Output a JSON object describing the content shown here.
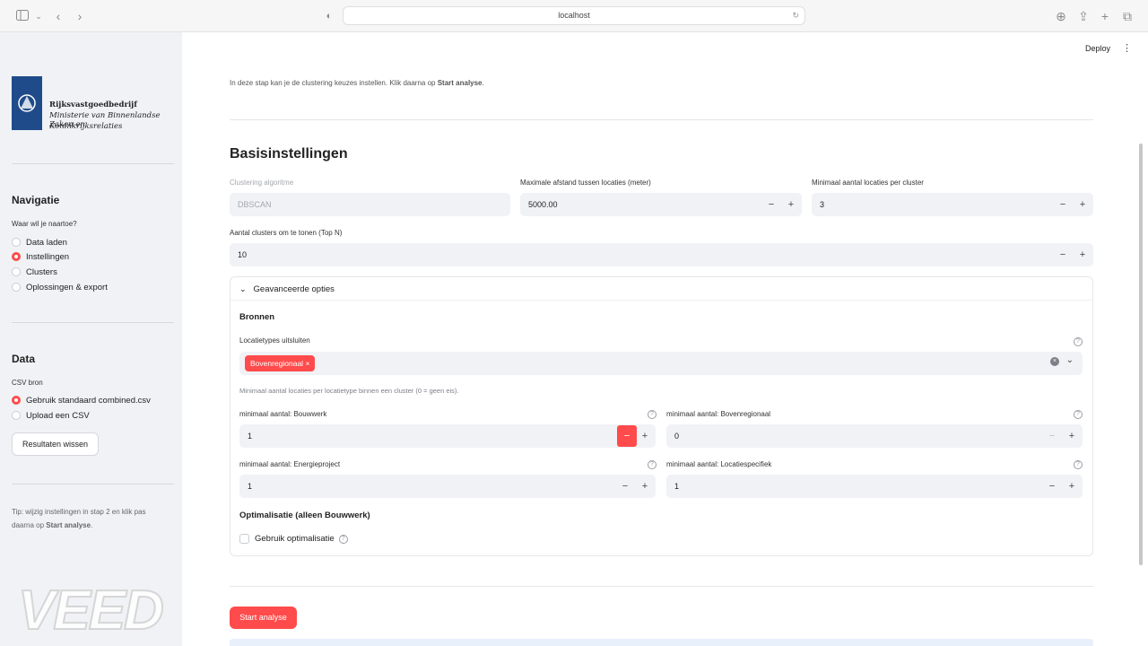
{
  "browser": {
    "url": "localhost"
  },
  "sidebar": {
    "logo": {
      "line1": "Rijksvastgoedbedrijf",
      "line2": "Ministerie van Binnenlandse Zaken en",
      "line3": "Koninkrijksrelaties"
    },
    "nav_title": "Navigatie",
    "nav_question": "Waar wil je naartoe?",
    "nav_items": [
      {
        "label": "Data laden",
        "selected": false
      },
      {
        "label": "Instellingen",
        "selected": true
      },
      {
        "label": "Clusters",
        "selected": false
      },
      {
        "label": "Oplossingen & export",
        "selected": false
      }
    ],
    "data_title": "Data",
    "csv_label": "CSV bron",
    "csv_items": [
      {
        "label": "Gebruik standaard combined.csv",
        "selected": true
      },
      {
        "label": "Upload een CSV",
        "selected": false
      }
    ],
    "clear_button": "Resultaten wissen",
    "tip_part1": "Tip: wijzig instellingen in stap 2 en klik pas daarna op ",
    "tip_bold": "Start analyse",
    "tip_part2": "."
  },
  "header": {
    "deploy": "Deploy",
    "menu_icon": "⋮"
  },
  "main": {
    "intro_part1": "In deze stap kan je de clustering keuzes instellen. Klik daarna op ",
    "intro_bold": "Start analyse",
    "intro_part2": ".",
    "section_title": "Basisinstellingen",
    "algo_label": "Clustering algoritme",
    "algo_value": "DBSCAN",
    "distance_label": "Maximale afstand tussen locaties (meter)",
    "distance_value": "5000.00",
    "min_per_cluster_label": "Minimaal aantal locaties per cluster",
    "min_per_cluster_value": "3",
    "topn_label": "Aantal clusters om te tonen (Top N)",
    "topn_value": "10",
    "minus": "−",
    "plus": "+",
    "advanced": {
      "title": "Geavanceerde opties",
      "sources_title": "Bronnen",
      "exclude_label": "Locatietypes uitsluiten",
      "exclude_tag": "Bovenregionaal",
      "caption": "Minimaal aantal locaties per locatietype binnen een cluster (0 = geen eis).",
      "fields": [
        {
          "label": "minimaal aantal: Bouwwerk",
          "value": "1"
        },
        {
          "label": "minimaal aantal: Bovenregionaal",
          "value": "0"
        },
        {
          "label": "minimaal aantal: Energieproject",
          "value": "1"
        },
        {
          "label": "minimaal aantal: Locatiespecifiek",
          "value": "1"
        }
      ],
      "opt_title": "Optimalisatie (alleen Bouwwerk)",
      "opt_checkbox": "Gebruik optimalisatie"
    },
    "start_button": "Start analyse"
  },
  "watermark": "VEED",
  "colors": {
    "accent": "#ff4b4b",
    "sidebar_bg": "#f0f2f6",
    "input_bg": "#f0f2f6"
  }
}
